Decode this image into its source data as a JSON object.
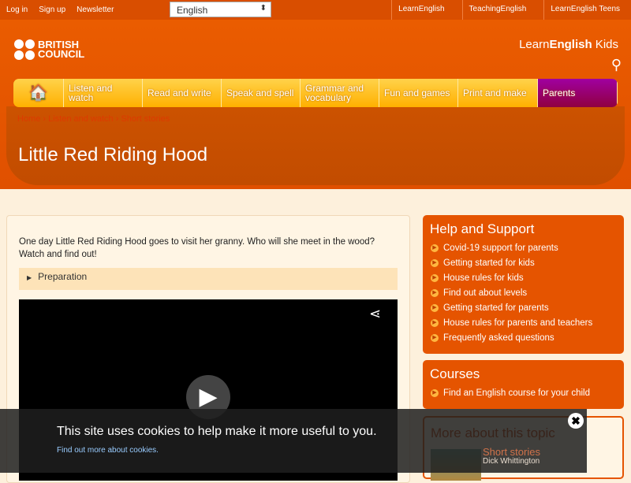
{
  "topbar": {
    "login": "Log in",
    "signup": "Sign up",
    "newsletter": "Newsletter",
    "language": "English",
    "links": [
      "LearnEnglish",
      "TeachingEnglish",
      "LearnEnglish Teens"
    ]
  },
  "header": {
    "logo": "BRITISH COUNCIL",
    "logo_line1": "BRITISH",
    "logo_line2": "COUNCIL",
    "site_name_light": "Learn",
    "site_name_bold": "English",
    "site_name_suffix": " Kids"
  },
  "nav": [
    "Listen and watch",
    "Read and write",
    "Speak and spell",
    "Grammar and vocabulary",
    "Fun and games",
    "Print and make",
    "Parents"
  ],
  "breadcrumb": "Home › Listen and watch › Short stories",
  "page_title": "Little Red Riding Hood",
  "main": {
    "intro": "One day Little Red Riding Hood goes to visit her granny. Who will she meet in the wood? Watch and find out!",
    "preparation": "Preparation"
  },
  "help": {
    "title": "Help and Support",
    "items": [
      "Covid-19 support for parents",
      "Getting started for kids",
      "House rules for kids",
      "Find out about levels",
      "Getting started for parents",
      "House rules for parents and teachers",
      "Frequently asked questions"
    ]
  },
  "courses": {
    "title": "Courses",
    "items": [
      "Find an English course for your child"
    ]
  },
  "more": {
    "title": "More about this topic",
    "category": "Short stories",
    "story": "Dick Whittington"
  },
  "cookie": {
    "message": "This site uses cookies to help make it more useful to you.",
    "link": "Find out more about cookies."
  }
}
